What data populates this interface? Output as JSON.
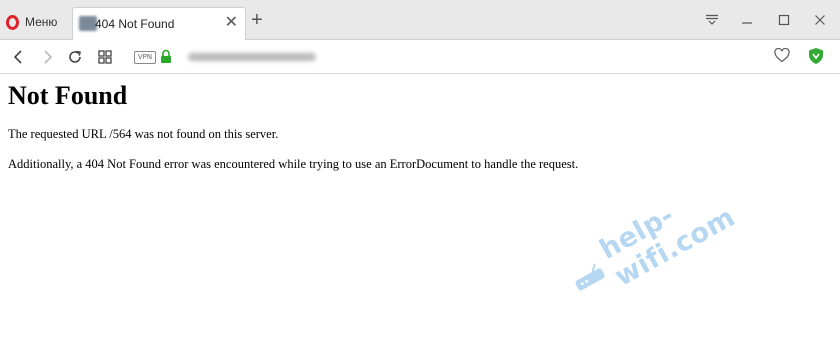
{
  "browser": {
    "menu_label": "Меню",
    "tab": {
      "title": "404 Not Found",
      "close_label": "✕"
    },
    "new_tab_label": "+",
    "window_controls": {
      "tab_menu_icon": "tab-menu-icon",
      "minimize_label": "—",
      "maximize_label": "☐",
      "close_label": "✕"
    },
    "address_bar": {
      "vpn_label": "VPN"
    }
  },
  "page": {
    "heading": "Not Found",
    "message": "The requested URL /564 was not found on this server.",
    "detail": "Additionally, a 404 Not Found error was encountered while trying to use an ErrorDocument to handle the request."
  },
  "watermark": {
    "text": "help-wifi.com"
  },
  "colors": {
    "opera_red": "#e0232b",
    "lock_green": "#2aa82a",
    "shield_green": "#32a835",
    "watermark_blue": "#6eafe4"
  }
}
